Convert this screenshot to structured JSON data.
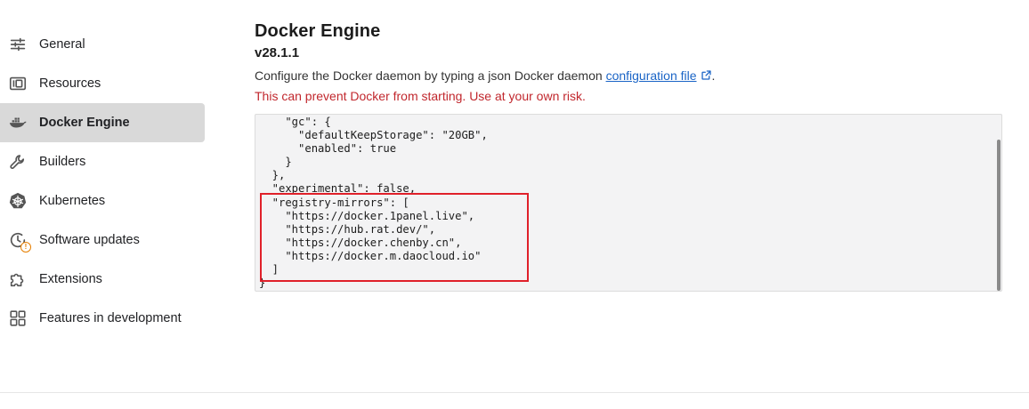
{
  "sidebar": {
    "items": [
      {
        "label": "General",
        "icon": "sliders-icon",
        "active": false
      },
      {
        "label": "Resources",
        "icon": "resources-icon",
        "active": false
      },
      {
        "label": "Docker Engine",
        "icon": "docker-whale-icon",
        "active": true
      },
      {
        "label": "Builders",
        "icon": "wrench-icon",
        "active": false
      },
      {
        "label": "Kubernetes",
        "icon": "kubernetes-helm-icon",
        "active": false
      },
      {
        "label": "Software updates",
        "icon": "clock-update-icon",
        "active": false,
        "badge": "!"
      },
      {
        "label": "Extensions",
        "icon": "puzzle-icon",
        "active": false
      },
      {
        "label": "Features in development",
        "icon": "grid-icon",
        "active": false
      }
    ]
  },
  "main": {
    "title": "Docker Engine",
    "version": "v28.1.1",
    "description_prefix": "Configure the Docker daemon by typing a json Docker daemon ",
    "description_link": "configuration file",
    "description_suffix": ".",
    "warning": "This can prevent Docker from starting. Use at your own risk."
  },
  "editor": {
    "lines": [
      "    \"gc\": {",
      "      \"defaultKeepStorage\": \"20GB\",",
      "      \"enabled\": true",
      "    }",
      "  },",
      "  \"experimental\": false,",
      "  \"registry-mirrors\": [",
      "    \"https://docker.1panel.live\",",
      "    \"https://hub.rat.dev/\",",
      "    \"https://docker.chenby.cn\",",
      "    \"https://docker.m.daocloud.io\"",
      "  ]",
      "}"
    ]
  },
  "colors": {
    "warning": "#c1272d",
    "link": "#1a64c6",
    "highlight": "#e0202a",
    "active_bg": "#d9d9d9"
  }
}
